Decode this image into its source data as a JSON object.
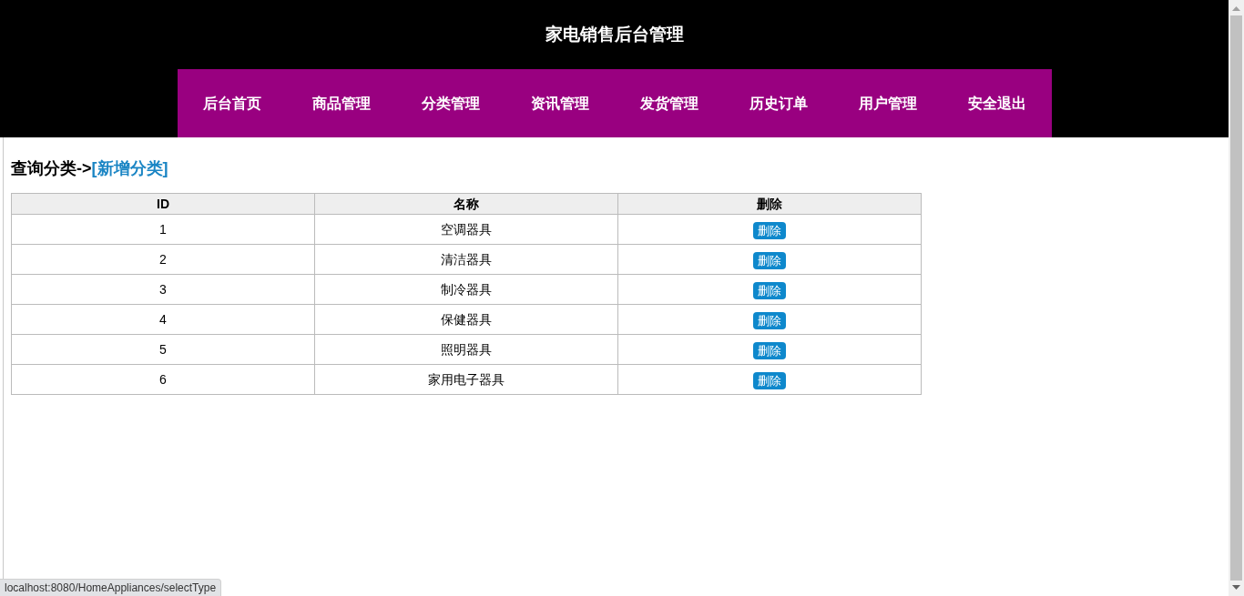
{
  "header": {
    "title": "家电销售后台管理"
  },
  "nav": [
    "后台首页",
    "商品管理",
    "分类管理",
    "资讯管理",
    "发货管理",
    "历史订单",
    "用户管理",
    "安全退出"
  ],
  "breadcrumb": {
    "current": "查询分类->",
    "link": "[新增分类]"
  },
  "table": {
    "columns": [
      "ID",
      "名称",
      "删除"
    ],
    "rows": [
      {
        "id": "1",
        "name": "空调器具",
        "action": "删除"
      },
      {
        "id": "2",
        "name": "清洁器具",
        "action": "删除"
      },
      {
        "id": "3",
        "name": "制冷器具",
        "action": "删除"
      },
      {
        "id": "4",
        "name": "保健器具",
        "action": "删除"
      },
      {
        "id": "5",
        "name": "照明器具",
        "action": "删除"
      },
      {
        "id": "6",
        "name": "家用电子器具",
        "action": "删除"
      }
    ]
  },
  "status_bar": "localhost:8080/HomeAppliances/selectType"
}
